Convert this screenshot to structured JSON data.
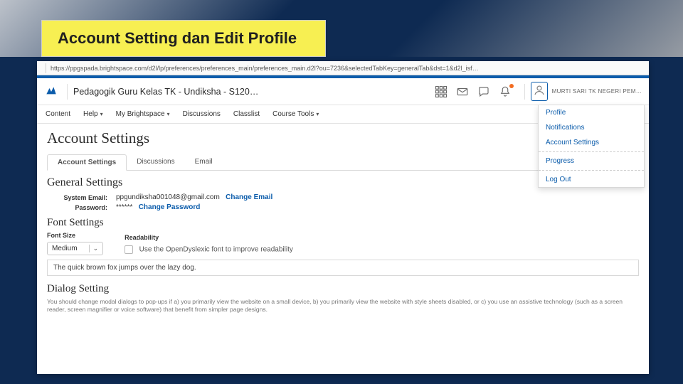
{
  "slide": {
    "title": "Account Setting dan Edit Profile"
  },
  "url": "https://ppgspada.brightspace.com/d2l/lp/preferences/preferences_main/preferences_main.d2l?ou=7236&selectedTabKey=generalTab&dst=1&d2l_isf…",
  "course_title": "Pedagogik Guru Kelas TK - Undiksha - S120…",
  "user_name": "MURTI SARI TK NEGERI PEM…",
  "nav": {
    "content": "Content",
    "help": "Help",
    "mybrightspace": "My Brightspace",
    "discussions": "Discussions",
    "classlist": "Classlist",
    "course_tools": "Course Tools"
  },
  "user_menu": {
    "profile": "Profile",
    "notifications": "Notifications",
    "account_settings": "Account Settings",
    "progress": "Progress",
    "logout": "Log Out"
  },
  "page": {
    "title": "Account Settings",
    "tabs": {
      "account": "Account Settings",
      "discussions": "Discussions",
      "email": "Email"
    },
    "general": {
      "heading": "General Settings",
      "email_label": "System Email:",
      "email_value": "ppgundiksha001048@gmail.com",
      "change_email": "Change Email",
      "password_label": "Password:",
      "password_value": "******",
      "change_password": "Change Password"
    },
    "font": {
      "heading": "Font Settings",
      "size_label": "Font Size",
      "readability_label": "Readability",
      "size_value": "Medium",
      "checkbox_label": "Use the OpenDyslexic font to improve readability",
      "preview": "The quick brown fox jumps over the lazy dog."
    },
    "dialog": {
      "heading": "Dialog Setting",
      "desc": "You should change modal dialogs to pop-ups if a) you primarily view the website on a small device, b) you primarily view the website with style sheets disabled, or c) you use an assistive technology (such as a screen reader, screen magnifier or voice software) that benefit from simpler page designs."
    }
  }
}
